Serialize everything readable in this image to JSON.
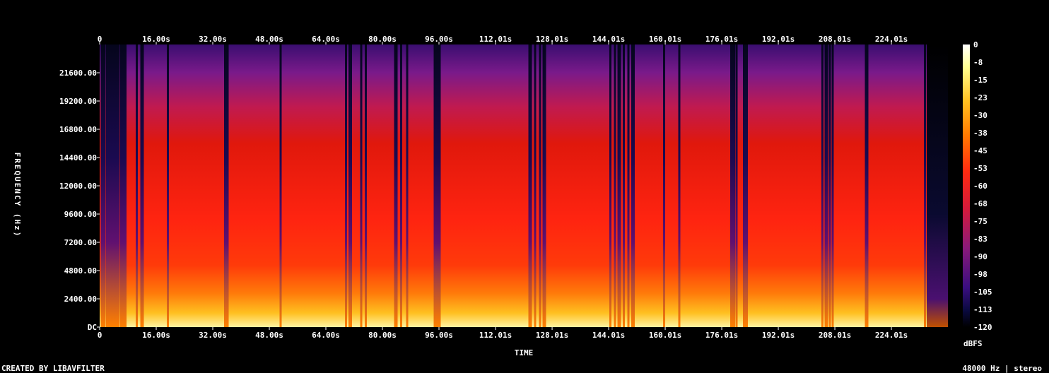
{
  "chart_data": {
    "type": "heatmap",
    "title": "",
    "xlabel": "TIME",
    "ylabel": "FREQUENCY (Hz)",
    "colorbar_label": "dBFS",
    "x_tick_labels": [
      "0",
      "16.00s",
      "32.00s",
      "48.00s",
      "64.00s",
      "80.00s",
      "96.00s",
      "112.01s",
      "128.01s",
      "144.01s",
      "160.01s",
      "176.01s",
      "192.01s",
      "208.01s",
      "224.01s"
    ],
    "x_tick_values": [
      0,
      16.0,
      32.0,
      48.0,
      64.0,
      80.0,
      96.0,
      112.01,
      128.01,
      144.01,
      160.01,
      176.01,
      192.01,
      208.01,
      224.01
    ],
    "x_range": [
      0,
      234
    ],
    "y_tick_labels": [
      "DC",
      "2400.00",
      "4800.00",
      "7200.00",
      "9600.00",
      "12000.00",
      "14400.00",
      "16800.00",
      "19200.00",
      "21600.00"
    ],
    "y_tick_values": [
      0,
      2400,
      4800,
      7200,
      9600,
      12000,
      14400,
      16800,
      19200,
      21600
    ],
    "y_range": [
      0,
      24000
    ],
    "colorbar_ticks": [
      "0",
      "-8",
      "-15",
      "-23",
      "-30",
      "-38",
      "-45",
      "-53",
      "-60",
      "-68",
      "-75",
      "-83",
      "-90",
      "-98",
      "-105",
      "-113",
      "-120"
    ],
    "colorbar_range": [
      -120,
      0
    ],
    "colormap": [
      "#000000",
      "#0a0a40",
      "#3a0e80",
      "#8a1a7a",
      "#d51a3a",
      "#ff2a10",
      "#ff7a00",
      "#ffc020",
      "#ffff90",
      "#ffffff"
    ],
    "dropout_times": [
      0.8,
      1.3,
      2.0,
      2.6,
      3.3,
      3.9,
      4.6,
      5.3,
      6.0,
      6.7,
      7.3,
      10.5,
      12.0,
      19.3,
      35.5,
      36.0,
      51.2,
      69.7,
      70.9,
      74.0,
      75.3,
      83.8,
      85.3,
      87.0,
      95.0,
      95.6,
      96.2,
      121.8,
      123.2,
      124.6,
      125.8,
      144.5,
      145.8,
      147.0,
      148.3,
      149.6,
      150.9,
      159.7,
      164.0,
      178.9,
      179.5,
      180.2,
      182.5,
      183.1,
      204.5,
      205.6,
      206.6,
      207.4,
      217.0,
      233.5
    ]
  },
  "footer": {
    "left": "CREATED BY LIBAVFILTER",
    "right": "48000 Hz | stereo"
  }
}
